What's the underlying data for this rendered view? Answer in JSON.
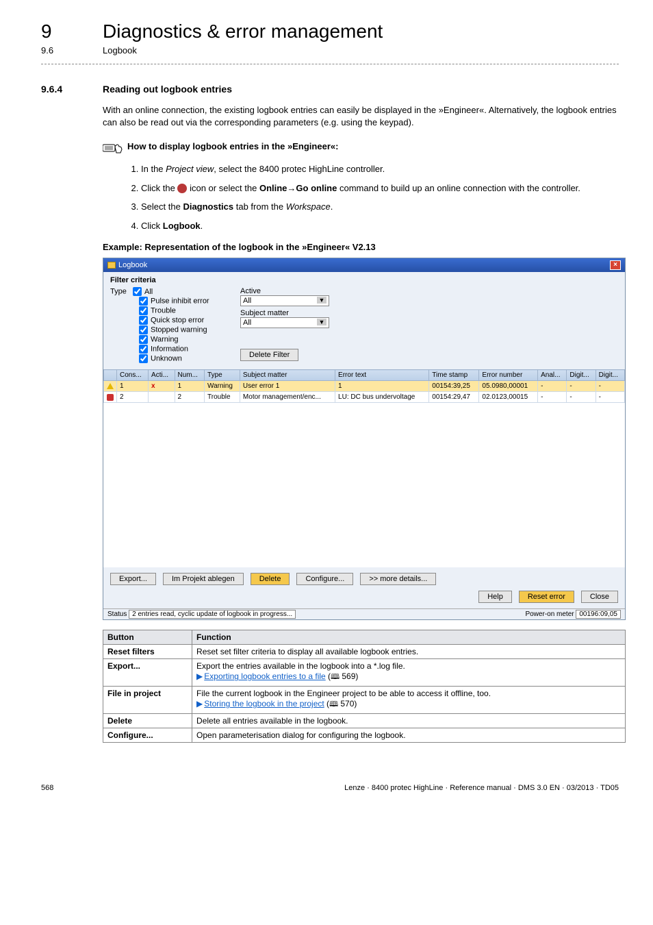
{
  "chapter": {
    "num": "9",
    "title": "Diagnostics & error management"
  },
  "subsection": {
    "num": "9.6",
    "title": "Logbook"
  },
  "section": {
    "num": "9.6.4",
    "title": "Reading out logbook entries"
  },
  "intro": "With an online connection, the existing logbook entries can easily be displayed in the »Engineer«. Alternatively, the logbook entries can also be read out via the corresponding parameters (e.g. using the keypad).",
  "howto": "How to display logbook entries in the »Engineer«:",
  "steps": {
    "s1_a": "In the ",
    "s1_i": "Project view",
    "s1_b": ", select the 8400 protec HighLine controller.",
    "s2_a": "Click the ",
    "s2_b": " icon or select the ",
    "s2_c": "Online→Go online",
    "s2_d": " command to build up an online connection with the controller.",
    "s3_a": "Select the ",
    "s3_b": "Diagnostics",
    "s3_c": " tab from the ",
    "s3_d": "Workspace",
    "s3_e": ".",
    "s4_a": "Click ",
    "s4_b": "Logbook",
    "s4_c": "."
  },
  "example": "Example: Representation of the logbook in the »Engineer« V2.13",
  "logbook": {
    "title": "Logbook",
    "filter_criteria": "Filter criteria",
    "type": "Type",
    "all": "All",
    "cb": {
      "pulse": "Pulse inhibit error",
      "trouble": "Trouble",
      "quick": "Quick stop error",
      "stopped": "Stopped warning",
      "warning": "Warning",
      "info": "Information",
      "unknown": "Unknown"
    },
    "active": "Active",
    "subject": "Subject matter",
    "delfilter": "Delete Filter",
    "headers": {
      "cons": "Cons...",
      "acti": "Acti...",
      "num": "Num...",
      "type": "Type",
      "subj": "Subject matter",
      "err": "Error text",
      "time": "Time stamp",
      "errnum": "Error number",
      "anal": "Anal...",
      "digit1": "Digit...",
      "digit2": "Digit..."
    },
    "row1": {
      "cons": "1",
      "acti": "x",
      "num": "1",
      "type": "Warning",
      "subj": "User error 1",
      "err": "1",
      "time": "00154:39,25",
      "errnum": "05.0980,00001",
      "a": "-",
      "d1": "-",
      "d2": "-"
    },
    "row2": {
      "cons": "2",
      "acti": "",
      "num": "2",
      "type": "Trouble",
      "subj": "Motor management/enc...",
      "err": "LU: DC bus undervoltage",
      "time": "00154:29,47",
      "errnum": "02.0123,00015",
      "a": "-",
      "d1": "-",
      "d2": "-"
    },
    "buttons": {
      "export": "Export...",
      "inproj": "Im Projekt ablegen",
      "delete": "Delete",
      "configure": "Configure...",
      "more": ">> more details...",
      "help": "Help",
      "reset": "Reset error",
      "close": "Close"
    },
    "status": "2 entries read, cyclic update of logbook in progress...",
    "power_label": "Power-on meter",
    "power_val": "00196:09,05"
  },
  "table": {
    "h1": "Button",
    "h2": "Function",
    "r1a": "Reset filters",
    "r1b": "Reset set filter criteria to display all available logbook entries.",
    "r2a": "Export...",
    "r2b": "Export the entries available in the logbook into a *.log file.",
    "r2link": "Exporting logbook entries to a file",
    "r2page": " 569)",
    "r3a": "File in project",
    "r3b": "File the current logbook in the Engineer project to be able to access it offline, too.",
    "r3link": "Storing the logbook in the project",
    "r3page": " 570)",
    "r4a": "Delete",
    "r4b": "Delete all entries available in the logbook.",
    "r5a": "Configure...",
    "r5b": "Open parameterisation dialog for configuring the logbook."
  },
  "footer": {
    "page": "568",
    "info": "Lenze · 8400 protec HighLine · Reference manual · DMS 3.0 EN · 03/2013 · TD05"
  }
}
